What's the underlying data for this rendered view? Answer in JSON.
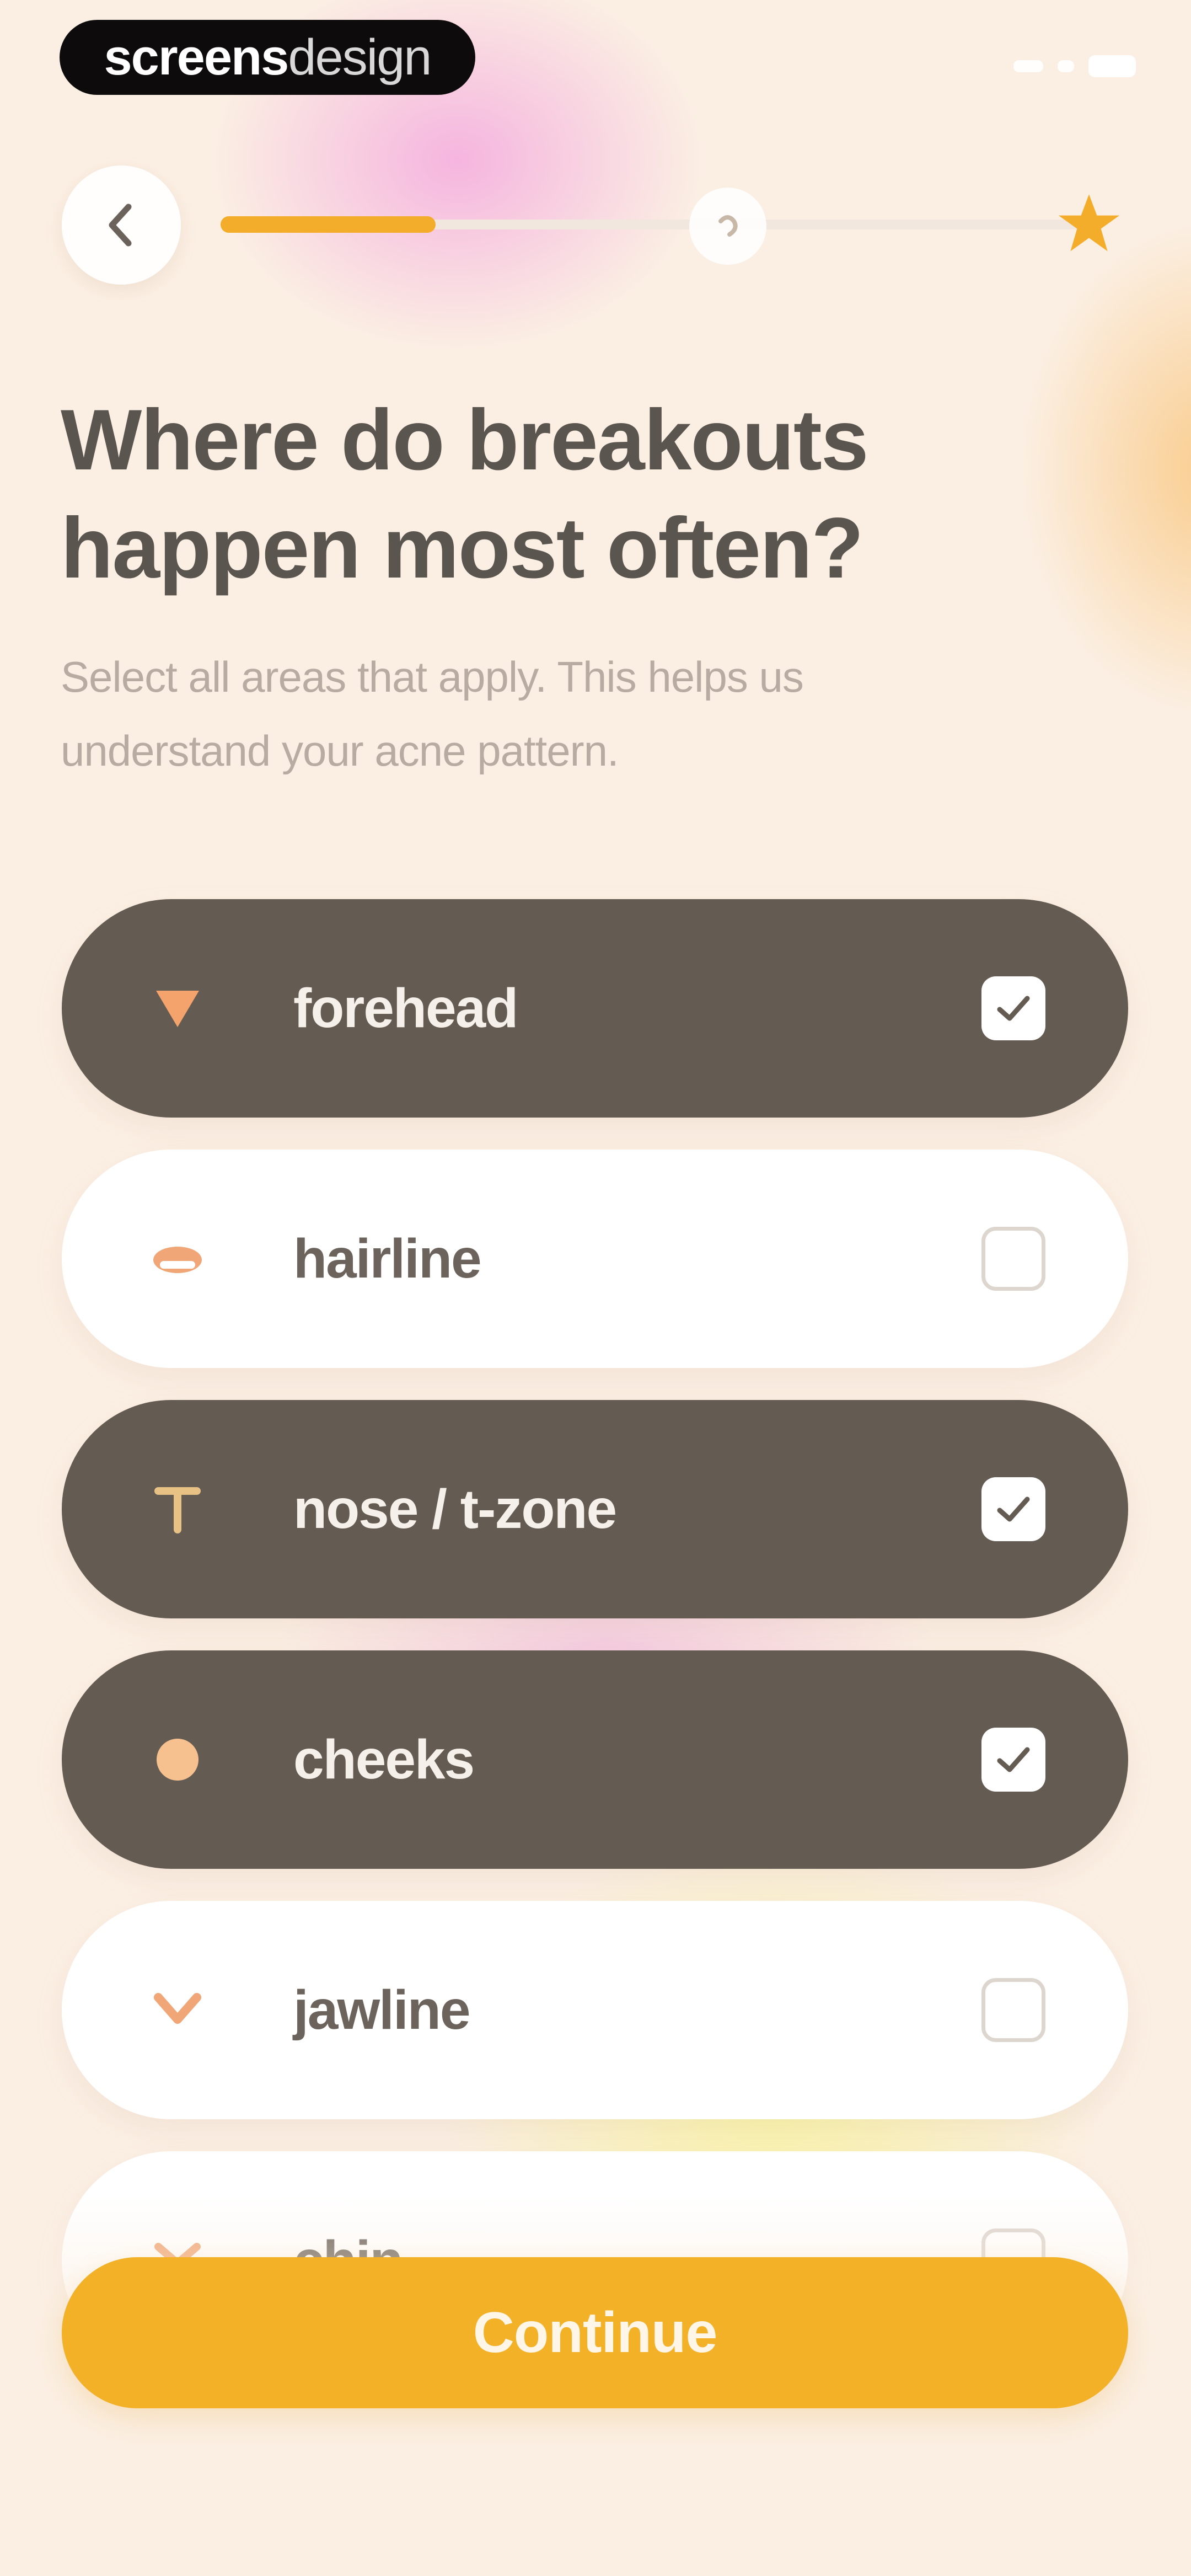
{
  "brand": {
    "bold": "screens",
    "light": "design"
  },
  "progress": {
    "fraction": 0.25
  },
  "header": {
    "title": "Where do breakouts happen most often?",
    "subtitle": "Select all areas that apply. This helps us understand your acne pattern."
  },
  "options": [
    {
      "label": "forehead",
      "icon": "forehead-icon",
      "selected": true
    },
    {
      "label": "hairline",
      "icon": "hairline-icon",
      "selected": false
    },
    {
      "label": "nose / t-zone",
      "icon": "t-zone-icon",
      "selected": true
    },
    {
      "label": "cheeks",
      "icon": "cheeks-icon",
      "selected": true
    },
    {
      "label": "jawline",
      "icon": "jawline-icon",
      "selected": false
    },
    {
      "label": "chin",
      "icon": "chin-icon",
      "selected": false
    }
  ],
  "continue_label": "Continue",
  "colors": {
    "accent": "#f3b128",
    "selected_bg": "#645b52",
    "text_dark": "#5b5550",
    "text_muted": "#b7aba2"
  }
}
